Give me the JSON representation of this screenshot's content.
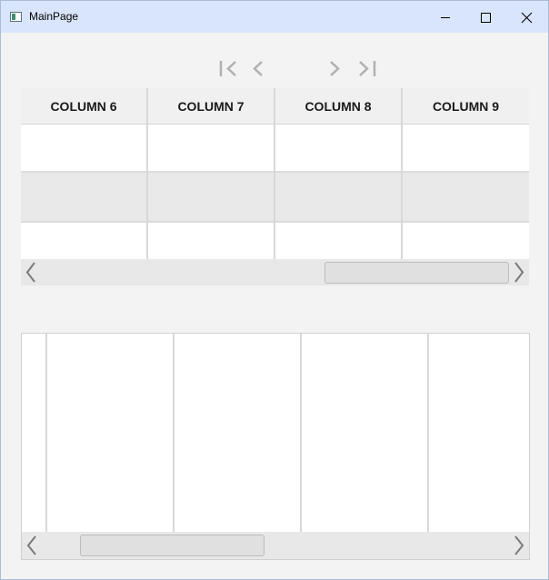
{
  "window": {
    "title": "MainPage",
    "minimize_icon": "minimize-icon",
    "maximize_icon": "maximize-icon",
    "close_icon": "close-icon"
  },
  "pager": {
    "first_icon": "first-page-icon",
    "prev_icon": "previous-page-icon",
    "next_icon": "next-page-icon",
    "last_icon": "last-page-icon",
    "color": "#b0b0b0"
  },
  "grid_top": {
    "columns": [
      "COLUMN 6",
      "COLUMN 7",
      "COLUMN 8",
      "COLUMN 9"
    ],
    "row_count": 3,
    "alternate_row_color": "#e9e9e9"
  },
  "grid_bottom": {
    "row_count": 0
  },
  "colors": {
    "titlebar": "#d9e5fb",
    "window_bg": "#f3f3f3",
    "gridline": "#d8d8d8",
    "scrollbar_track": "#e8e8e8",
    "arrow": "#7a7a7a"
  }
}
